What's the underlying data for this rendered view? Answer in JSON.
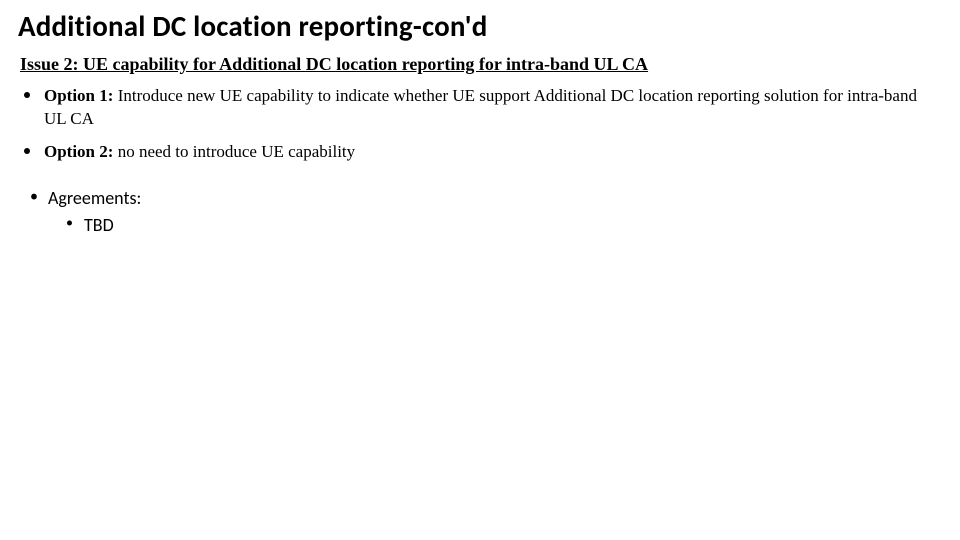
{
  "title": "Additional DC location reporting-con'd",
  "issue_heading": "Issue 2:  UE capability for Additional DC location reporting for intra-band UL CA",
  "options": [
    {
      "label": "Option 1:",
      "text": " Introduce new UE capability to indicate whether UE support Additional DC location reporting solution for intra-band UL CA"
    },
    {
      "label": "Option 2:",
      "text": " no need to introduce UE capability"
    }
  ],
  "agreements": {
    "heading": "Agreements:",
    "items": [
      "TBD"
    ]
  }
}
